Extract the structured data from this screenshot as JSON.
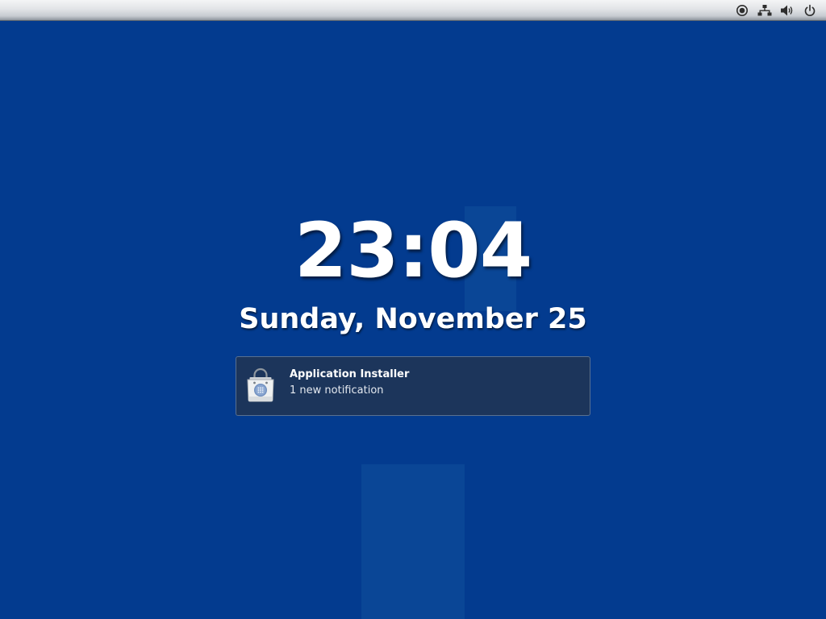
{
  "topbar": {
    "tray_icons": [
      {
        "name": "accessibility-icon"
      },
      {
        "name": "network-wired-icon"
      },
      {
        "name": "volume-icon"
      },
      {
        "name": "power-icon"
      }
    ]
  },
  "lockscreen": {
    "time": "23:04",
    "date": "Sunday, November 25"
  },
  "notification": {
    "icon": "software-bag-icon",
    "title": "Application Installer",
    "body": "1 new notification"
  },
  "colors": {
    "background": "#033b8f",
    "notification_bg": "#1c355b",
    "notification_border": "#59708f"
  }
}
